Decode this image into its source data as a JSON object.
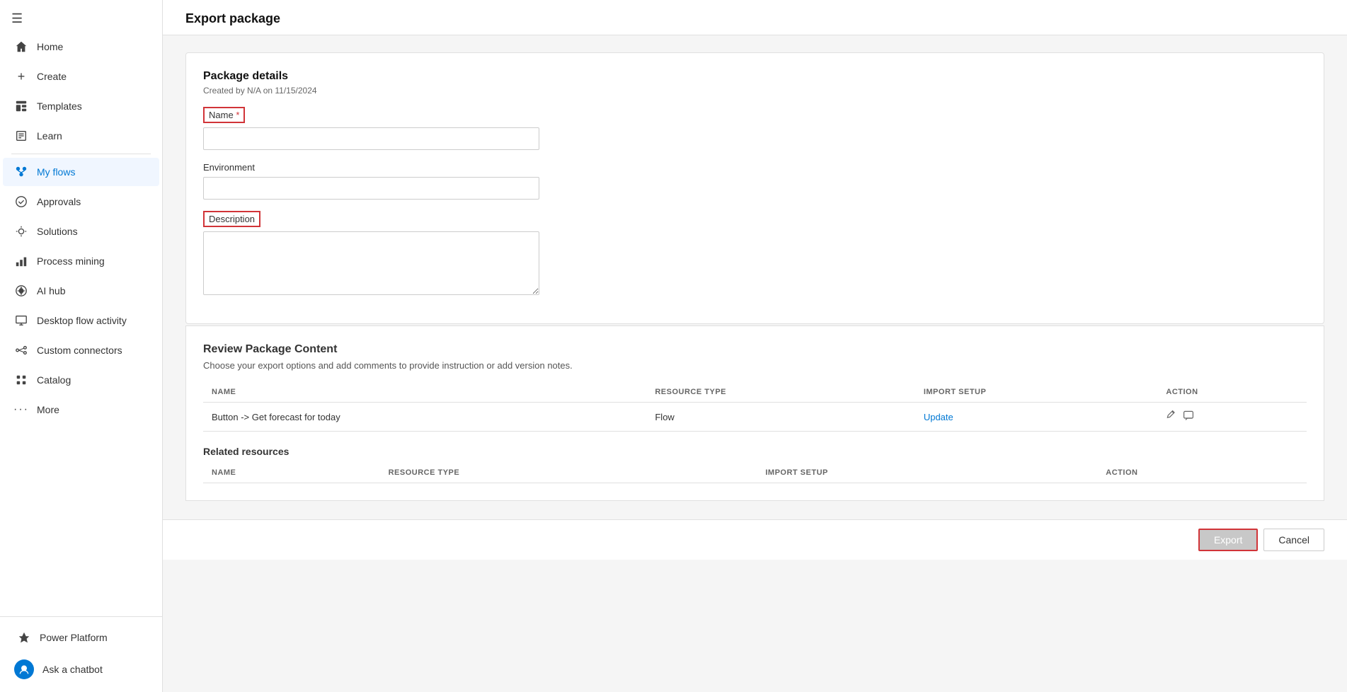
{
  "sidebar": {
    "hamburger_icon": "☰",
    "items": [
      {
        "id": "home",
        "label": "Home",
        "icon": "⌂",
        "active": false
      },
      {
        "id": "create",
        "label": "Create",
        "icon": "+",
        "active": false
      },
      {
        "id": "templates",
        "label": "Templates",
        "icon": "📄",
        "active": false
      },
      {
        "id": "learn",
        "label": "Learn",
        "icon": "📖",
        "active": false
      },
      {
        "id": "my-flows",
        "label": "My flows",
        "icon": "🔵",
        "active": true
      },
      {
        "id": "approvals",
        "label": "Approvals",
        "icon": "✅",
        "active": false
      },
      {
        "id": "solutions",
        "label": "Solutions",
        "icon": "💡",
        "active": false
      },
      {
        "id": "process-mining",
        "label": "Process mining",
        "icon": "📊",
        "active": false
      },
      {
        "id": "ai-hub",
        "label": "AI hub",
        "icon": "🤖",
        "active": false
      },
      {
        "id": "desktop-flow-activity",
        "label": "Desktop flow activity",
        "icon": "🖥",
        "active": false
      },
      {
        "id": "custom-connectors",
        "label": "Custom connectors",
        "icon": "🔌",
        "active": false
      },
      {
        "id": "catalog",
        "label": "Catalog",
        "icon": "📁",
        "active": false
      },
      {
        "id": "more",
        "label": "More",
        "icon": "...",
        "active": false
      }
    ],
    "bottom": {
      "power_platform_label": "Power Platform",
      "chatbot_label": "Ask a chatbot"
    }
  },
  "page": {
    "title": "Export package"
  },
  "package_details": {
    "section_title": "Package details",
    "subtitle": "Created by N/A on 11/15/2024",
    "name_label": "Name",
    "required_star": "*",
    "name_placeholder": "",
    "name_value": "",
    "environment_label": "Environment",
    "environment_placeholder": "",
    "environment_value": "",
    "description_label": "Description",
    "description_placeholder": "",
    "description_value": ""
  },
  "review_package": {
    "section_title": "Review Package Content",
    "description": "Choose your export options and add comments to provide instruction or add version notes.",
    "table_headers": {
      "name": "NAME",
      "resource_type": "RESOURCE TYPE",
      "import_setup": "IMPORT SETUP",
      "action": "ACTION"
    },
    "rows": [
      {
        "name": "Button -> Get forecast for today",
        "resource_type": "Flow",
        "import_setup": "Update",
        "import_setup_link": true
      }
    ],
    "related_resources": {
      "title": "Related resources",
      "table_headers": {
        "name": "NAME",
        "resource_type": "RESOURCE TYPE",
        "import_setup": "IMPORT SETUP",
        "action": "ACTION"
      }
    }
  },
  "footer": {
    "export_label": "Export",
    "cancel_label": "Cancel"
  }
}
